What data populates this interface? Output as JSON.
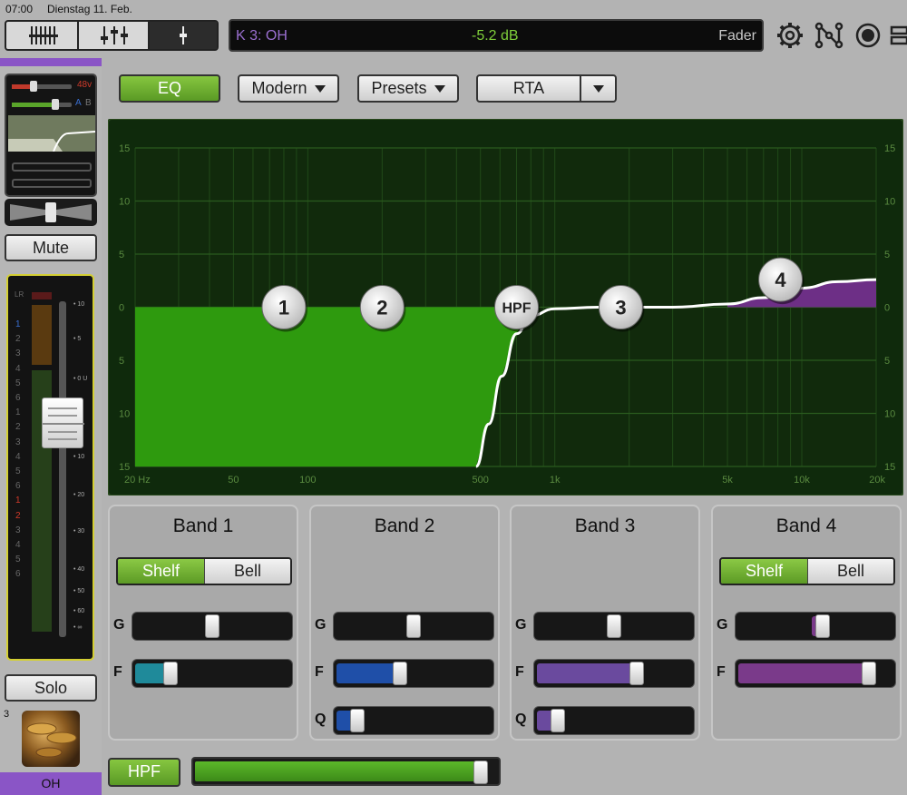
{
  "status": {
    "time": "07:00",
    "date": "Dienstag 11. Feb."
  },
  "header": {
    "channel": "K 3: OH",
    "level": "-5.2 dB",
    "mode": "Fader",
    "icons": [
      "settings-icon",
      "routing-icon",
      "record-icon",
      "layout-icon"
    ]
  },
  "sidebar": {
    "phantom": "48v",
    "ab_a": "A",
    "ab_b": "B",
    "mute": "Mute",
    "solo": "Solo",
    "meter_label": "LR",
    "channel_number": "3",
    "channel_name": "OH",
    "scale_labels": [
      "10",
      "5",
      "0 U",
      "5",
      "10",
      "20",
      "30",
      "40",
      "50",
      "60",
      "∞"
    ],
    "meter_left_numbers": [
      "1",
      "2",
      "3",
      "4",
      "5",
      "6",
      "1",
      "2",
      "3",
      "4",
      "5",
      "6",
      "1",
      "2",
      "3",
      "4",
      "5",
      "6"
    ]
  },
  "toolbar": {
    "eq": "EQ",
    "mode": "Modern",
    "presets": "Presets",
    "rta": "RTA"
  },
  "chart_data": {
    "type": "line",
    "title": "",
    "xlabel": "",
    "ylabel": "",
    "x_scale": "log",
    "xlim": [
      20,
      20000
    ],
    "ylim": [
      -15,
      15
    ],
    "x_ticks": [
      {
        "value": 20,
        "label": "20 Hz"
      },
      {
        "value": 50,
        "label": "50"
      },
      {
        "value": 100,
        "label": "100"
      },
      {
        "value": 500,
        "label": "500"
      },
      {
        "value": 1000,
        "label": "1k"
      },
      {
        "value": 5000,
        "label": "5k"
      },
      {
        "value": 10000,
        "label": "10k"
      },
      {
        "value": 20000,
        "label": "20k"
      }
    ],
    "y_ticks": [
      {
        "value": 15,
        "label": "15"
      },
      {
        "value": 10,
        "label": "10"
      },
      {
        "value": 5,
        "label": "5"
      },
      {
        "value": 0,
        "label": "0"
      },
      {
        "value": -5,
        "label": "5"
      },
      {
        "value": -10,
        "label": "10"
      },
      {
        "value": -15,
        "label": "15"
      }
    ],
    "grid": true,
    "curve": [
      {
        "f": 480,
        "db": -15
      },
      {
        "f": 540,
        "db": -11
      },
      {
        "f": 610,
        "db": -6.5
      },
      {
        "f": 700,
        "db": -2.5
      },
      {
        "f": 800,
        "db": -0.8
      },
      {
        "f": 1000,
        "db": -0.15
      },
      {
        "f": 1500,
        "db": 0
      },
      {
        "f": 3000,
        "db": 0
      },
      {
        "f": 5000,
        "db": 0.3
      },
      {
        "f": 7000,
        "db": 0.9
      },
      {
        "f": 10000,
        "db": 1.8
      },
      {
        "f": 14000,
        "db": 2.4
      },
      {
        "f": 20000,
        "db": 2.6
      }
    ],
    "handles": [
      {
        "label": "1",
        "f": 80,
        "db": 0
      },
      {
        "label": "2",
        "f": 200,
        "db": 0
      },
      {
        "label": "HPF",
        "f": 700,
        "db": 0
      },
      {
        "label": "3",
        "f": 1850,
        "db": 0
      },
      {
        "label": "4",
        "f": 8200,
        "db": 2.6
      }
    ]
  },
  "bands": [
    {
      "title": "Band 1",
      "shelf": "Shelf",
      "bell": "Bell",
      "g": "G",
      "f": "F",
      "q": "",
      "g_value": 0.5,
      "f_value": 0.2,
      "q_value": null,
      "color": "#1f8a9a"
    },
    {
      "title": "Band 2",
      "shelf": "",
      "bell": "",
      "g": "G",
      "f": "F",
      "q": "Q",
      "g_value": 0.5,
      "f_value": 0.4,
      "q_value": 0.1,
      "color": "#1f4fa8"
    },
    {
      "title": "Band 3",
      "shelf": "",
      "bell": "",
      "g": "G",
      "f": "F",
      "q": "Q",
      "g_value": 0.5,
      "f_value": 0.66,
      "q_value": 0.1,
      "color": "#6a4a9e"
    },
    {
      "title": "Band 4",
      "shelf": "Shelf",
      "bell": "Bell",
      "g": "G",
      "f": "F",
      "q": "",
      "g_value": 0.55,
      "f_value": 0.88,
      "q_value": null,
      "color": "#7a3a8a"
    }
  ],
  "hpf": {
    "label": "HPF",
    "value": 0.98
  }
}
